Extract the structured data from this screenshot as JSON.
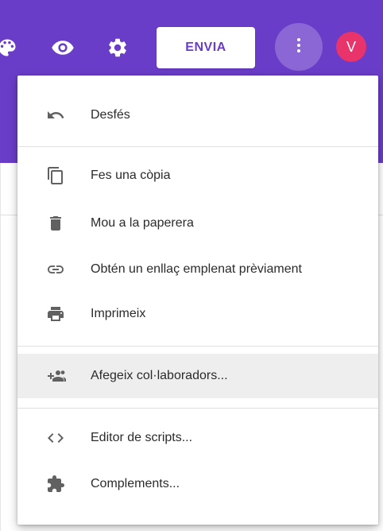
{
  "header": {
    "bg_color": "#6a3dc8",
    "icons": [
      "palette-icon",
      "eye-icon",
      "gear-icon"
    ],
    "send_label": "ENVIA",
    "more_icon": "more-vert-icon",
    "avatar_letter": "V",
    "avatar_color": "#e8336b"
  },
  "menu": {
    "items": [
      {
        "label": "Desfés",
        "icon": "undo-icon"
      },
      {
        "label": "Fes una còpia",
        "icon": "copy-icon"
      },
      {
        "label": "Mou a la paperera",
        "icon": "trash-icon"
      },
      {
        "label": "Obtén un enllaç emplenat prèviament",
        "icon": "link-icon"
      },
      {
        "label": "Imprimeix",
        "icon": "print-icon"
      },
      {
        "label": "Afegeix col·laboradors...",
        "icon": "add-people-icon",
        "highlighted": true
      },
      {
        "label": "Editor de scripts...",
        "icon": "code-icon"
      },
      {
        "label": "Complements...",
        "icon": "puzzle-icon"
      }
    ]
  }
}
